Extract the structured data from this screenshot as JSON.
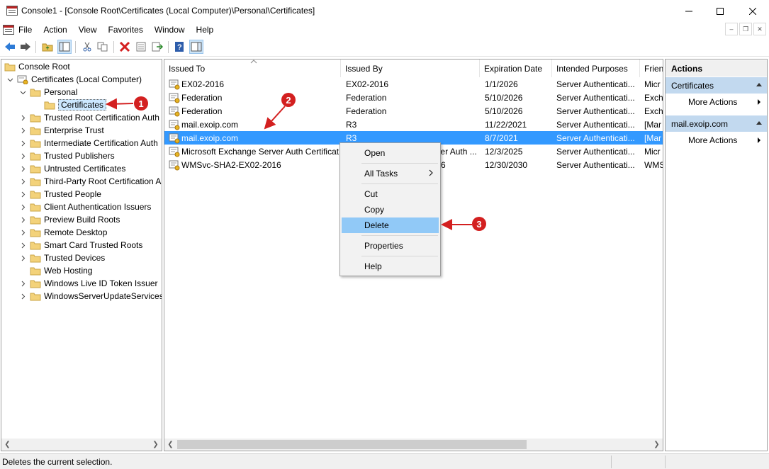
{
  "window": {
    "title": "Console1 - [Console Root\\Certificates (Local Computer)\\Personal\\Certificates]"
  },
  "menu": [
    "File",
    "Action",
    "View",
    "Favorites",
    "Window",
    "Help"
  ],
  "tree": {
    "root": "Console Root",
    "snapin": "Certificates (Local Computer)",
    "personal": "Personal",
    "certificates": "Certificates",
    "stores": [
      "Trusted Root Certification Auth",
      "Enterprise Trust",
      "Intermediate Certification Auth",
      "Trusted Publishers",
      "Untrusted Certificates",
      "Third-Party Root Certification A",
      "Trusted People",
      "Client Authentication Issuers",
      "Preview Build Roots",
      "Remote Desktop",
      "Smart Card Trusted Roots",
      "Trusted Devices",
      "Web Hosting",
      "Windows Live ID Token Issuer",
      "WindowsServerUpdateServices"
    ]
  },
  "list": {
    "columns": [
      "Issued To",
      "Issued By",
      "Expiration Date",
      "Intended Purposes",
      "Frien"
    ],
    "rows": [
      [
        "EX02-2016",
        "EX02-2016",
        "1/1/2026",
        "Server Authenticati...",
        "Micr"
      ],
      [
        "Federation",
        "Federation",
        "5/10/2026",
        "Server Authenticati...",
        "Exch"
      ],
      [
        "Federation",
        "Federation",
        "5/10/2026",
        "Server Authenticati...",
        "Exch"
      ],
      [
        "mail.exoip.com",
        "R3",
        "11/22/2021",
        "Server Authenticati...",
        "[Mar"
      ],
      [
        "mail.exoip.com",
        "R3",
        "8/7/2021",
        "Server Authenticati...",
        "[Mar"
      ],
      [
        "Microsoft Exchange Server Auth Certificate",
        "Microsoft Exchange Server Auth ...",
        "12/3/2025",
        "Server Authenticati...",
        "Micr"
      ],
      [
        "WMSvc-SHA2-EX02-2016",
        "WMSvc-SHA2-EX02-2016",
        "12/30/2030",
        "Server Authenticati...",
        "WMS"
      ]
    ],
    "selected_index": 4
  },
  "actions": {
    "title": "Actions",
    "group1": "Certificates",
    "more1": "More Actions",
    "group2": "mail.exoip.com",
    "more2": "More Actions"
  },
  "context_menu": {
    "open": "Open",
    "all_tasks": "All Tasks",
    "cut": "Cut",
    "copy": "Copy",
    "delete": "Delete",
    "properties": "Properties",
    "help": "Help"
  },
  "callouts": [
    "1",
    "2",
    "3"
  ],
  "status": "Deletes the current selection.",
  "colors": {
    "selection": "#3399ff",
    "menu_highlight": "#91c9f7",
    "callout": "#d32020",
    "actions_group": "#c2d9ef"
  }
}
